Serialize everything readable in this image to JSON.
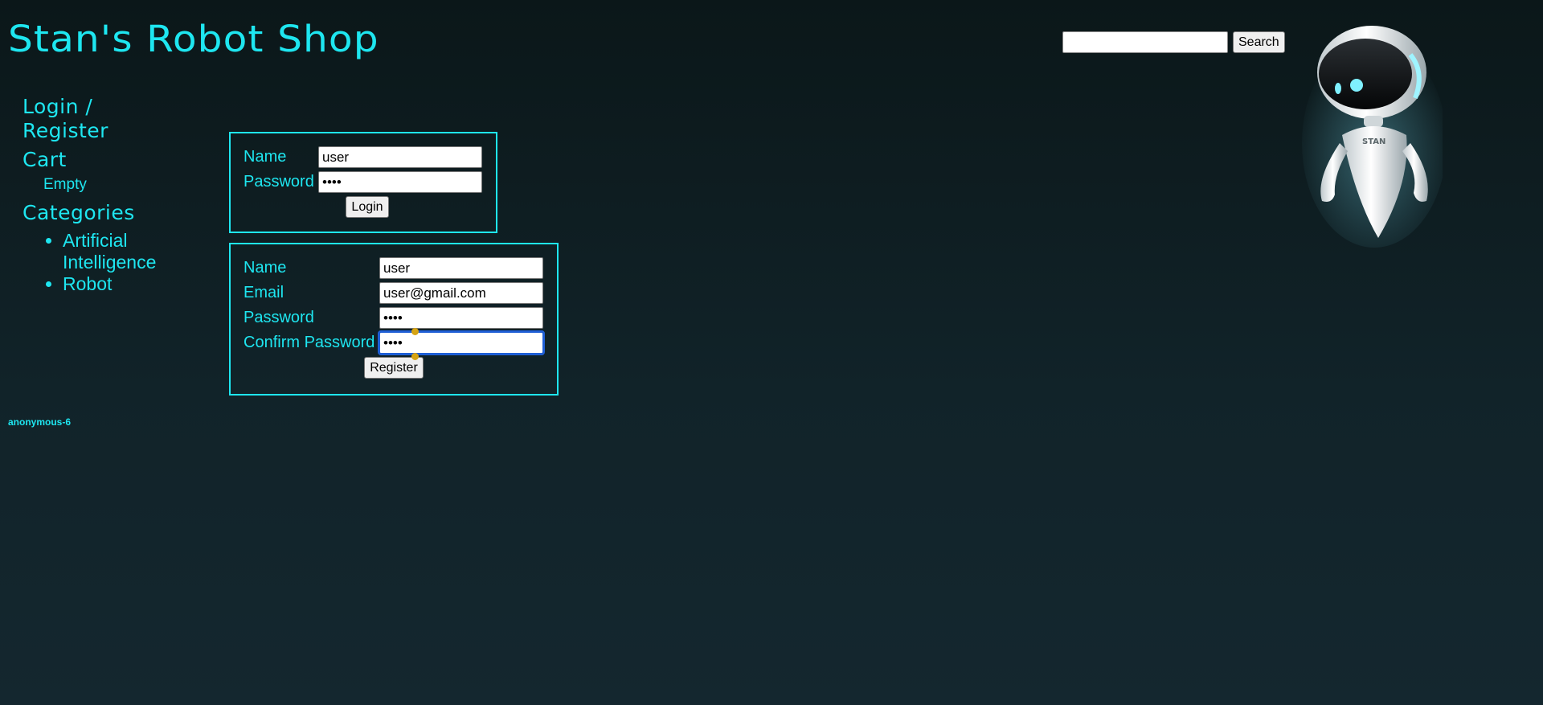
{
  "header": {
    "title": "Stan's Robot Shop",
    "search_placeholder": "",
    "search_button": "Search"
  },
  "sidebar": {
    "login_link": "Login / Register",
    "cart_heading": "Cart",
    "cart_status": "Empty",
    "categories_heading": "Categories",
    "categories": [
      {
        "label": "Artificial Intelligence"
      },
      {
        "label": "Robot"
      }
    ]
  },
  "login_form": {
    "name_label": "Name",
    "name_value": "user",
    "password_label": "Password",
    "password_value": "user",
    "submit_label": "Login"
  },
  "register_form": {
    "name_label": "Name",
    "name_value": "user",
    "email_label": "Email",
    "email_value": "user@gmail.com",
    "password_label": "Password",
    "password_value": "user",
    "confirm_label": "Confirm Password",
    "confirm_value": "user",
    "submit_label": "Register"
  },
  "footer": {
    "session_user": "anonymous-6"
  },
  "mascot": {
    "name": "robot-mascot",
    "chest_label": "STAN"
  },
  "colors": {
    "accent": "#1ee6f0",
    "background_top": "#0b1719",
    "background_bottom": "#14272f"
  }
}
